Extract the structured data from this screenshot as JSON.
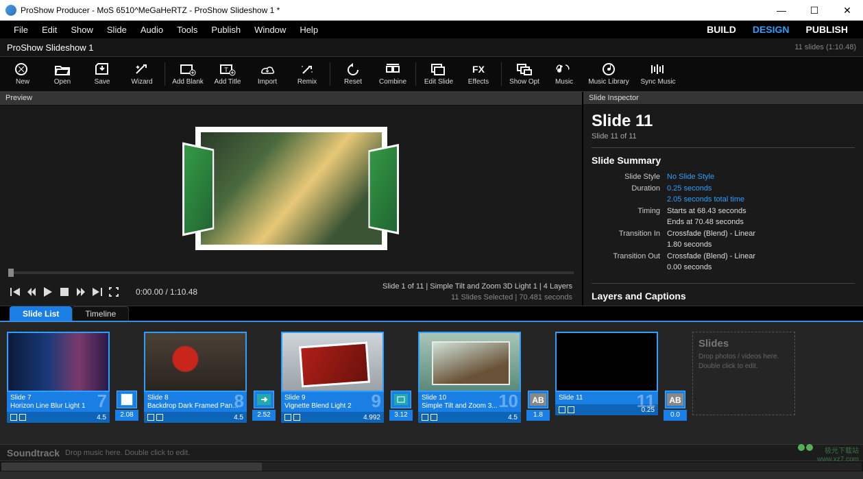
{
  "titlebar": {
    "title": "ProShow Producer - MoS 6510^MeGaHeRTZ - ProShow Slideshow 1 *"
  },
  "menu": {
    "items": [
      "File",
      "Edit",
      "Show",
      "Slide",
      "Audio",
      "Tools",
      "Publish",
      "Window",
      "Help"
    ],
    "modes": {
      "build": "BUILD",
      "design": "DESIGN",
      "publish": "PUBLISH"
    }
  },
  "project": {
    "name": "ProShow Slideshow 1",
    "status": "11 slides (1:10.48)"
  },
  "toolbar": [
    {
      "name": "new-button",
      "label": "New"
    },
    {
      "name": "open-button",
      "label": "Open"
    },
    {
      "name": "save-button",
      "label": "Save"
    },
    {
      "name": "wizard-button",
      "label": "Wizard"
    },
    {
      "sep": true
    },
    {
      "name": "add-blank-button",
      "label": "Add Blank"
    },
    {
      "name": "add-title-button",
      "label": "Add Title"
    },
    {
      "name": "import-button",
      "label": "Import"
    },
    {
      "name": "remix-button",
      "label": "Remix"
    },
    {
      "sep": true
    },
    {
      "name": "reset-button",
      "label": "Reset"
    },
    {
      "name": "combine-button",
      "label": "Combine"
    },
    {
      "sep": true
    },
    {
      "name": "edit-slide-button",
      "label": "Edit Slide"
    },
    {
      "name": "effects-button",
      "label": "Effects"
    },
    {
      "sep": true
    },
    {
      "name": "show-opt-button",
      "label": "Show Opt"
    },
    {
      "name": "music-button",
      "label": "Music"
    },
    {
      "name": "music-library-button",
      "label": "Music Library",
      "wide": true
    },
    {
      "name": "sync-music-button",
      "label": "Sync Music",
      "wide": true
    }
  ],
  "preview": {
    "header": "Preview",
    "time": "0:00.00 / 1:10.48",
    "right1": "Slide 1 of 11  |  Simple Tilt and Zoom 3D Light 1  |  4 Layers",
    "right2": "11 Slides Selected  |  70.481 seconds"
  },
  "inspector": {
    "header": "Slide Inspector",
    "title": "Slide 11",
    "sub": "Slide 11 of 11",
    "summary_h": "Slide Summary",
    "rows": {
      "style_k": "Slide Style",
      "style_v": "No Slide Style",
      "dur_k": "Duration",
      "dur_v1": "0.25 seconds",
      "dur_v2": "2.05 seconds total time",
      "timing_k": "Timing",
      "timing_v1": "Starts at 68.43 seconds",
      "timing_v2": "Ends at 70.48 seconds",
      "tin_k": "Transition In",
      "tin_v1": "Crossfade (Blend) - Linear",
      "tin_v2": "1.80 seconds",
      "tout_k": "Transition Out",
      "tout_v1": "Crossfade (Blend) - Linear",
      "tout_v2": "0.00 seconds"
    },
    "layers_h": "Layers and Captions"
  },
  "tabs": {
    "slide_list": "Slide List",
    "timeline": "Timeline"
  },
  "slides": [
    {
      "num": "7",
      "title": "Slide 7",
      "style": "Horizon Line Blur Light 1",
      "dur": "4.5",
      "tran": "2.08",
      "tran_icon": "blank"
    },
    {
      "num": "8",
      "title": "Slide 8",
      "style": "Backdrop Dark Framed Pan...",
      "dur": "4.5",
      "tran": "2.52",
      "tran_icon": "arrow"
    },
    {
      "num": "9",
      "title": "Slide 9",
      "style": "Vignette Blend Light 2",
      "dur": "4.992",
      "tran": "3.12",
      "tran_icon": "box"
    },
    {
      "num": "10",
      "title": "Slide 10",
      "style": "Simple Tilt and Zoom 3...",
      "dur": "4.5",
      "tran": "1.8",
      "tran_icon": "AB"
    },
    {
      "num": "11",
      "title": "Slide 11",
      "style": "",
      "dur": "0.25",
      "tran": "0.0",
      "tran_icon": "AB"
    }
  ],
  "dropzone": {
    "h": "Slides",
    "t1": "Drop photos / videos here.",
    "t2": "Double click to edit."
  },
  "soundtrack": {
    "label": "Soundtrack",
    "hint": "Drop music here.  Double click to edit."
  },
  "watermark": {
    "line1": "极光下载站",
    "line2": "www.xz7.com"
  }
}
